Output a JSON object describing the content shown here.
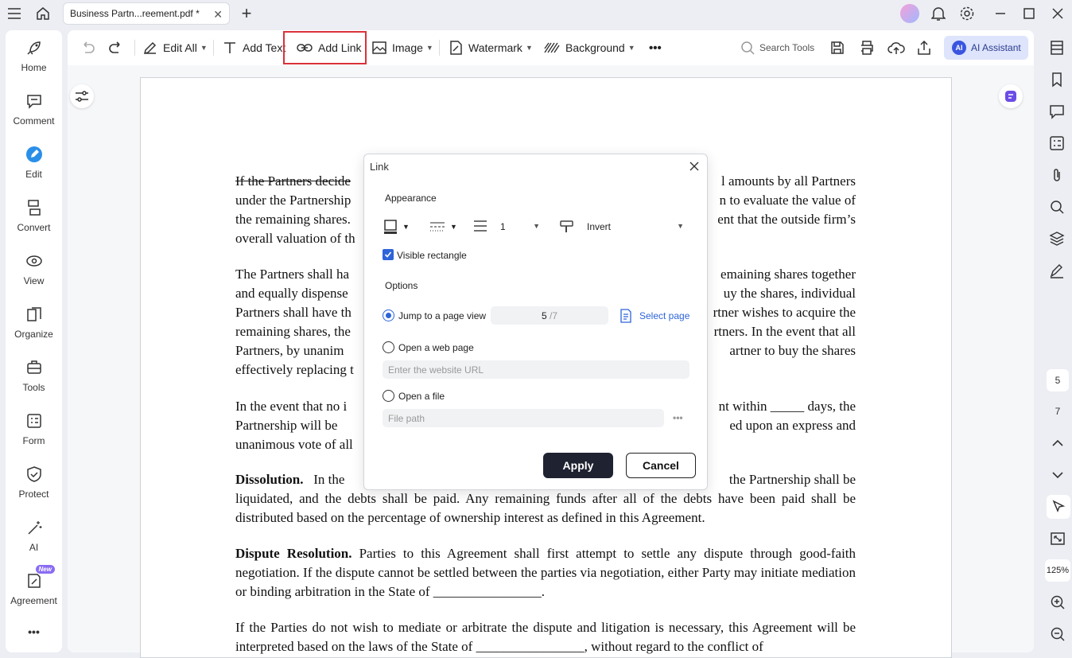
{
  "titlebar": {
    "tab_title": "Business Partn...reement.pdf *",
    "tab_close": "✕",
    "new_tab": "+"
  },
  "leftnav": {
    "items": [
      {
        "label": "Home",
        "icon": "rocket-icon"
      },
      {
        "label": "Comment",
        "icon": "comment-icon"
      },
      {
        "label": "Edit",
        "icon": "edit-icon"
      },
      {
        "label": "Convert",
        "icon": "convert-icon"
      },
      {
        "label": "View",
        "icon": "view-icon"
      },
      {
        "label": "Organize",
        "icon": "organize-icon"
      },
      {
        "label": "Tools",
        "icon": "tools-icon"
      },
      {
        "label": "Form",
        "icon": "form-icon"
      },
      {
        "label": "Protect",
        "icon": "shield-icon"
      },
      {
        "label": "AI",
        "icon": "magic-wand-icon"
      },
      {
        "label": "Agreement",
        "icon": "agreement-icon"
      }
    ],
    "new_badge": "New",
    "more": "•••"
  },
  "toolbar": {
    "edit_all": "Edit All",
    "add_text": "Add Text",
    "add_link": "Add Link",
    "image": "Image",
    "watermark": "Watermark",
    "background": "Background",
    "more": "•••",
    "search_tools": "Search Tools",
    "ai_assistant": "AI Assistant",
    "ai_logo": "AI"
  },
  "document": {
    "p1": [
      "If the Partners decide",
      "l amounts by all Partners",
      "under the Partnership",
      "n to evaluate the value of",
      "the remaining shares.",
      "ent that the outside firm’s",
      "overall valuation of th"
    ],
    "p2": [
      "The Partners shall ha",
      "emaining shares together",
      "and equally dispense",
      "uy the shares, individual",
      "Partners shall have th",
      "rtner wishes to acquire the",
      "remaining shares, the",
      "rtners. In the event that all",
      "Partners, by unanim",
      "artner to buy the shares",
      "effectively replacing t"
    ],
    "p3": [
      "In the event that no i",
      "nt within _____ days, the",
      "Partnership will be",
      "ed upon an express and",
      "unanimous vote of all"
    ],
    "p4_bold": "Dissolution.",
    "p4": [
      "In the",
      "the Partnership shall be"
    ],
    "p4_rest": "liquidated, and the debts shall be paid. Any remaining funds after all of the debts have been paid shall be distributed based on the percentage of ownership interest as defined in this Agreement.",
    "p5_bold": "Dispute Resolution.",
    "p5": "Parties to this Agreement shall first attempt to settle any dispute through good-faith negotiation. If the dispute cannot be settled between the parties via negotiation, either Party may initiate mediation or binding arbitration in the State of ________________.",
    "p6": "If the Parties do not wish to mediate or arbitrate the dispute and litigation is necessary, this Agreement will be interpreted based on the laws of the State of ________________, without regard to the conflict of"
  },
  "dialog": {
    "title": "Link",
    "appearance": "Appearance",
    "line_width": "1",
    "highlight": "Invert",
    "visible_rect": "Visible rectangle",
    "options": "Options",
    "jump_label": "Jump to a page view",
    "page_current": "5",
    "page_total": "/7",
    "select_page": "Select page",
    "web_label": "Open a web page",
    "web_placeholder": "Enter the website URL",
    "file_label": "Open a file",
    "file_placeholder": "File path",
    "file_more": "•••",
    "apply": "Apply",
    "cancel": "Cancel"
  },
  "rightbar": {
    "page_current": "5",
    "page_total": "7",
    "zoom": "125%"
  }
}
